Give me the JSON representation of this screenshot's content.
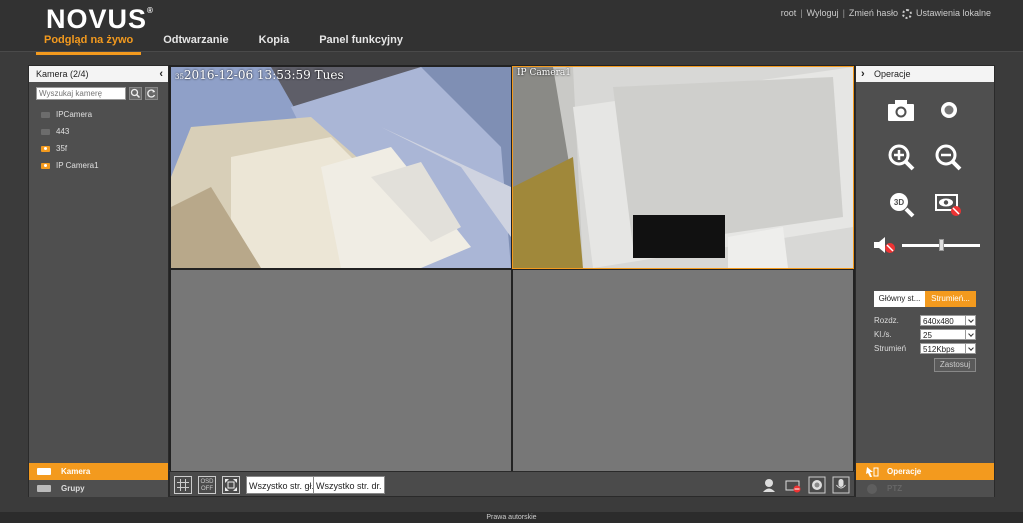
{
  "header": {
    "logo": "NOVUS",
    "logo_mark": "®",
    "nav": [
      "Podgląd na żywo",
      "Odtwarzanie",
      "Kopia",
      "Panel funkcyjny"
    ],
    "user": "root",
    "logout": "Wyloguj",
    "change_password": "Zmień hasło",
    "local_settings": "Ustawienia lokalne"
  },
  "left": {
    "title": "Kamera (2/4)",
    "search_placeholder": "Wyszukaj kamerę",
    "cameras": [
      {
        "name": "IPCamera",
        "active": false
      },
      {
        "name": "443",
        "active": false
      },
      {
        "name": "35f",
        "active": true
      },
      {
        "name": "IP Camera1",
        "active": true
      }
    ],
    "tab_camera": "Kamera",
    "tab_groups": "Grupy"
  },
  "video": {
    "cell1_osd_prefix": "35",
    "cell1_osd": "2016-12-06 13:53:59 Tues",
    "cell2_osd": "IP Camera1"
  },
  "toolbar": {
    "osd_label_top": "OSD",
    "osd_label_bottom": "OFF",
    "all_main": "Wszystko str. gł.",
    "all_sub": "Wszystko str. dr."
  },
  "right": {
    "title": "Operacje",
    "tab_main": "Główny st...",
    "tab_stream": "Strumień...",
    "resolution_label": "Rozdz.",
    "resolution_value": "640x480",
    "fps_label": "Kl./s.",
    "fps_value": "25",
    "bitrate_label": "Strumień",
    "bitrate_value": "512Kbps",
    "apply": "Zastosuj",
    "tab_operations": "Operacje",
    "tab_ptz": "PTZ",
    "volume_level": 0.5
  },
  "footer": {
    "text": "Prawa autorskie"
  },
  "colors": {
    "accent": "#f39a1e",
    "background": "#3b3b3b"
  }
}
